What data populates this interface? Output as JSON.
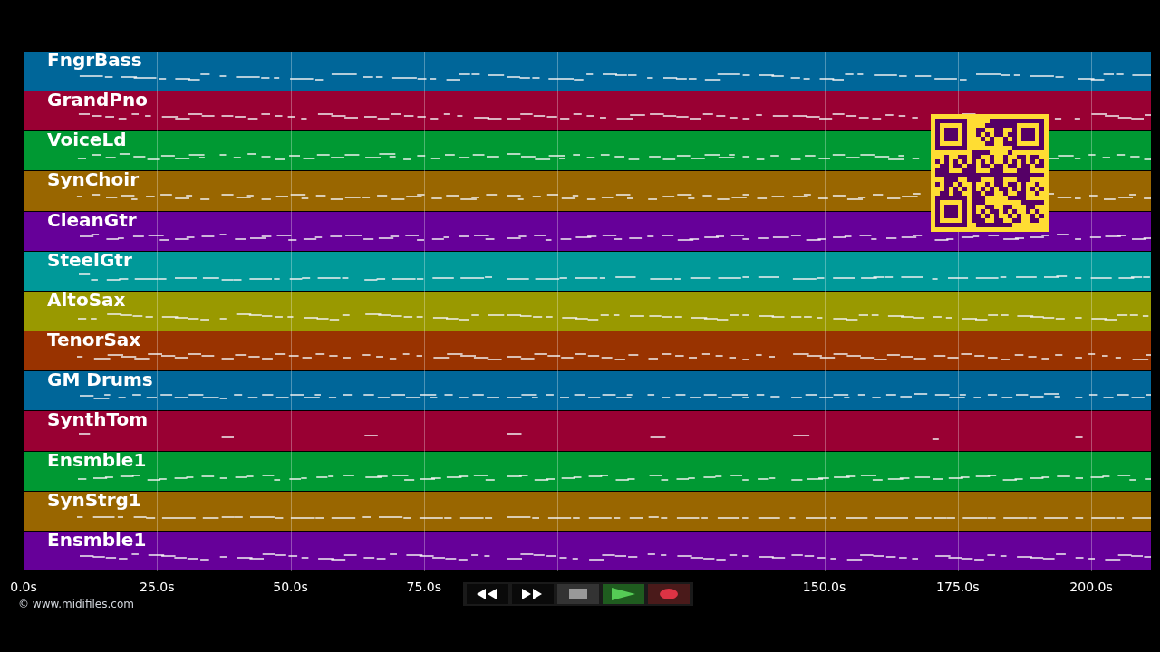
{
  "tracks": [
    {
      "name": "FngrBass",
      "color": "#006699"
    },
    {
      "name": "GrandPno",
      "color": "#990033"
    },
    {
      "name": "VoiceLd",
      "color": "#009933"
    },
    {
      "name": "SynChoir",
      "color": "#996600"
    },
    {
      "name": "CleanGtr",
      "color": "#660099"
    },
    {
      "name": "SteelGtr",
      "color": "#009999"
    },
    {
      "name": "AltoSax",
      "color": "#999900"
    },
    {
      "name": "TenorSax",
      "color": "#993300"
    },
    {
      "name": "GM Drums",
      "color": "#006699"
    },
    {
      "name": "SynthTom",
      "color": "#990033"
    },
    {
      "name": "Ensmble1",
      "color": "#009933"
    },
    {
      "name": "SynStrg1",
      "color": "#996600"
    },
    {
      "name": "Ensmble1",
      "color": "#660099"
    }
  ],
  "time_axis": [
    "0.0s",
    "25.0s",
    "50.0s",
    "75.0s",
    "150.0s",
    "175.0s",
    "200.0s"
  ],
  "credit": "© www.midifiles.com",
  "transport": [
    {
      "kind": "rewind"
    },
    {
      "kind": "forward"
    },
    {
      "kind": "stop"
    },
    {
      "kind": "play"
    },
    {
      "kind": "record"
    }
  ]
}
